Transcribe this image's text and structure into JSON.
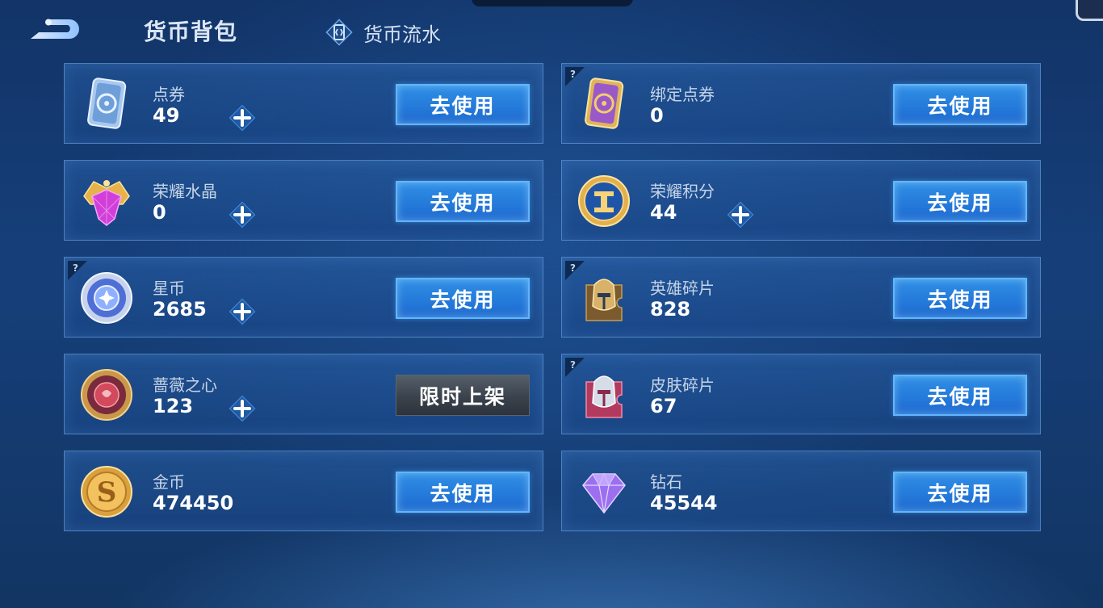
{
  "header": {
    "title": "货币背包",
    "flow_tab_label": "货币流水"
  },
  "currencies": [
    {
      "name": "点券",
      "count": "49",
      "has_plus": true,
      "has_help": false,
      "action": "去使用",
      "icon": "voucher-card-icon"
    },
    {
      "name": "绑定点券",
      "count": "0",
      "has_plus": false,
      "has_help": true,
      "action": "去使用",
      "icon": "bound-voucher-card-icon"
    },
    {
      "name": "荣耀水晶",
      "count": "0",
      "has_plus": true,
      "has_help": false,
      "action": "去使用",
      "icon": "glory-crystal-icon"
    },
    {
      "name": "荣耀积分",
      "count": "44",
      "has_plus": true,
      "has_help": false,
      "action": "去使用",
      "icon": "glory-points-icon"
    },
    {
      "name": "星币",
      "count": "2685",
      "has_plus": true,
      "has_help": true,
      "action": "去使用",
      "icon": "star-coin-icon"
    },
    {
      "name": "英雄碎片",
      "count": "828",
      "has_plus": false,
      "has_help": true,
      "action": "去使用",
      "icon": "hero-fragment-icon"
    },
    {
      "name": "蔷薇之心",
      "count": "123",
      "has_plus": true,
      "has_help": false,
      "action": "限时上架",
      "icon": "rose-heart-icon"
    },
    {
      "name": "皮肤碎片",
      "count": "67",
      "has_plus": false,
      "has_help": true,
      "action": "去使用",
      "icon": "skin-fragment-icon"
    },
    {
      "name": "金币",
      "count": "474450",
      "has_plus": false,
      "has_help": false,
      "action": "去使用",
      "icon": "gold-coin-icon"
    },
    {
      "name": "钻石",
      "count": "45544",
      "has_plus": false,
      "has_help": false,
      "action": "去使用",
      "icon": "diamond-icon"
    }
  ],
  "colors": {
    "accent": "#2f8fe6",
    "card_border": "#78afeb",
    "background": "#163f7a"
  }
}
